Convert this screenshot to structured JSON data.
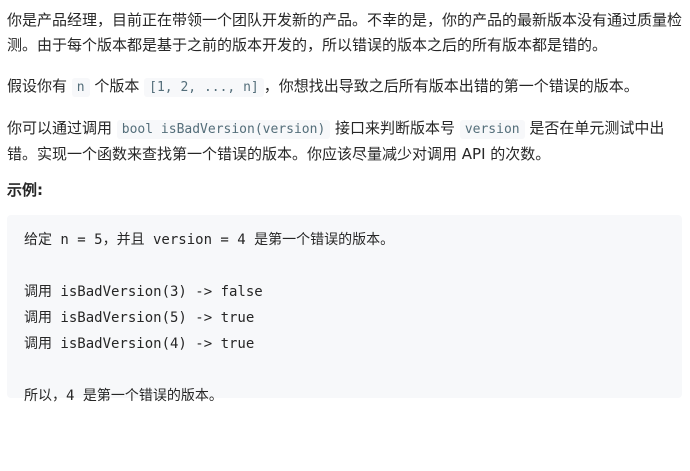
{
  "problem": {
    "p1": "你是产品经理，目前正在带领一个团队开发新的产品。不幸的是，你的产品的最新版本没有通过质量检测。由于每个版本都是基于之前的版本开发的，所以错误的版本之后的所有版本都是错的。",
    "p2": {
      "before": "假设你有 ",
      "code1": "n",
      "middle": " 个版本 ",
      "code2": "[1, 2, ..., n]",
      "after": "，你想找出导致之后所有版本出错的第一个错误的版本。"
    },
    "p3": {
      "before": "你可以通过调用 ",
      "code1": "bool isBadVersion(version)",
      "middle": " 接口来判断版本号 ",
      "code2": "version",
      "after": " 是否在单元测试中出错。实现一个函数来查找第一个错误的版本。你应该尽量减少对调用 API 的次数。"
    },
    "example_heading": "示例:",
    "example_lines": [
      "给定 n = 5，并且 version = 4 是第一个错误的版本。",
      "",
      "调用 isBadVersion(3) -> false",
      "调用 isBadVersion(5) -> true",
      "调用 isBadVersion(4) -> true",
      "",
      "所以，4 是第一个错误的版本。"
    ]
  }
}
